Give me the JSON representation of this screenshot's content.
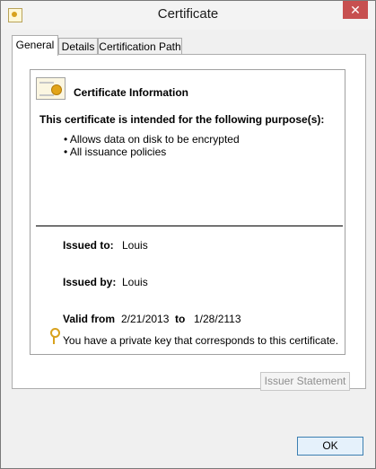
{
  "window": {
    "title": "Certificate",
    "close_label": "✕"
  },
  "tabs": [
    {
      "label": "General",
      "active": true
    },
    {
      "label": "Details",
      "active": false
    },
    {
      "label": "Certification Path",
      "active": false
    }
  ],
  "info": {
    "title": "Certificate Information",
    "purpose_heading": "This certificate is intended for the following purpose(s):",
    "purposes": [
      "• Allows data on disk to be encrypted",
      "• All issuance policies"
    ]
  },
  "details": {
    "issued_to_label": "Issued to:",
    "issued_to_value": "Louis",
    "issued_by_label": "Issued by:",
    "issued_by_value": "Louis",
    "valid_from_label": "Valid from",
    "valid_from_value": "2/21/2013",
    "to_label": "to",
    "valid_to_value": "1/28/2113",
    "private_key_note": "You have a private key that corresponds to this certificate."
  },
  "buttons": {
    "issuer_statement": "Issuer Statement",
    "ok": "OK"
  },
  "icons": {
    "window": "certificate-icon",
    "close": "close-icon",
    "info": "certificate-icon",
    "key": "key-icon"
  },
  "colors": {
    "close_button": "#c75050",
    "ok_border": "#3c7fb1",
    "key": "#d8a21e"
  }
}
